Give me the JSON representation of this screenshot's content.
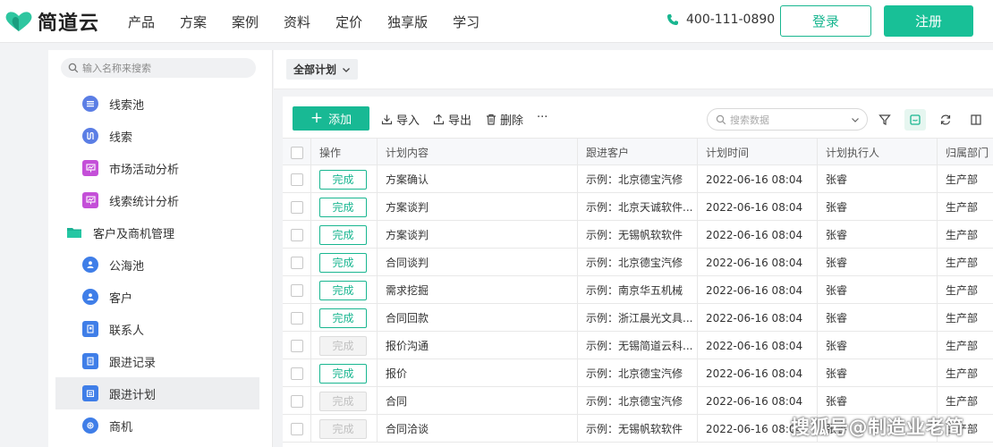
{
  "header": {
    "brand": "简道云",
    "nav": [
      "产品",
      "方案",
      "案例",
      "资料",
      "定价",
      "独享版",
      "学习"
    ],
    "phone": "400-111-0890",
    "login_label": "登录",
    "register_label": "注册"
  },
  "sidebar": {
    "search_placeholder": "输入名称来搜索",
    "items": [
      {
        "label": "线索池",
        "icon": "list-icon",
        "color": "#5b7ee5"
      },
      {
        "label": "线索",
        "icon": "funnel-icon",
        "color": "#5b7ee5"
      },
      {
        "label": "市场活动分析",
        "icon": "chart-icon",
        "color": "#c44fd8"
      },
      {
        "label": "线索统计分析",
        "icon": "chart-icon",
        "color": "#c44fd8"
      },
      {
        "label": "客户及商机管理",
        "icon": "folder-icon",
        "color": "#1ab394"
      },
      {
        "label": "公海池",
        "icon": "users-icon",
        "color": "#3f7ee8"
      },
      {
        "label": "客户",
        "icon": "user-icon",
        "color": "#3f7ee8"
      },
      {
        "label": "联系人",
        "icon": "contact-icon",
        "color": "#3f7ee8"
      },
      {
        "label": "跟进记录",
        "icon": "record-icon",
        "color": "#3f7ee8"
      },
      {
        "label": "跟进计划",
        "icon": "plan-icon",
        "color": "#3f7ee8"
      },
      {
        "label": "商机",
        "icon": "opportunity-icon",
        "color": "#3f7ee8"
      }
    ]
  },
  "view": {
    "selector_label": "全部计划"
  },
  "toolbar": {
    "add_label": "添加",
    "import_label": "导入",
    "export_label": "导出",
    "delete_label": "删除",
    "more_label": "···",
    "search_placeholder": "搜索数据"
  },
  "table": {
    "headers": [
      "操作",
      "计划内容",
      "跟进客户",
      "计划时间",
      "计划执行人",
      "归属部门"
    ],
    "rows": [
      {
        "action": "完成",
        "enabled": true,
        "content": "方案确认",
        "customer": "示例：北京德宝汽修",
        "time": "2022-06-16 08:04",
        "owner": "张睿",
        "dept": "生产部"
      },
      {
        "action": "完成",
        "enabled": true,
        "content": "方案谈判",
        "customer": "示例：北京天诚软件...",
        "time": "2022-06-16 08:04",
        "owner": "张睿",
        "dept": "生产部"
      },
      {
        "action": "完成",
        "enabled": true,
        "content": "方案谈判",
        "customer": "示例：无锡帆软软件",
        "time": "2022-06-16 08:04",
        "owner": "张睿",
        "dept": "生产部"
      },
      {
        "action": "完成",
        "enabled": true,
        "content": "合同谈判",
        "customer": "示例：北京德宝汽修",
        "time": "2022-06-16 08:04",
        "owner": "张睿",
        "dept": "生产部"
      },
      {
        "action": "完成",
        "enabled": true,
        "content": "需求挖掘",
        "customer": "示例：南京华五机械",
        "time": "2022-06-16 08:04",
        "owner": "张睿",
        "dept": "生产部"
      },
      {
        "action": "完成",
        "enabled": true,
        "content": "合同回款",
        "customer": "示例：浙江晨光文具...",
        "time": "2022-06-16 08:04",
        "owner": "张睿",
        "dept": "生产部"
      },
      {
        "action": "完成",
        "enabled": false,
        "content": "报价沟通",
        "customer": "示例：无锡简道云科...",
        "time": "2022-06-16 08:04",
        "owner": "张睿",
        "dept": "生产部"
      },
      {
        "action": "完成",
        "enabled": true,
        "content": "报价",
        "customer": "示例：北京德宝汽修",
        "time": "2022-06-16 08:04",
        "owner": "张睿",
        "dept": "生产部"
      },
      {
        "action": "完成",
        "enabled": false,
        "content": "合同",
        "customer": "示例：北京德宝汽修",
        "time": "2022-06-16 08:04",
        "owner": "张睿",
        "dept": "生产部"
      },
      {
        "action": "完成",
        "enabled": false,
        "content": "合同洽谈",
        "customer": "示例：无锡帆软软件",
        "time": "2022-06-16 08:04",
        "owner": "张睿",
        "dept": "生产部"
      }
    ]
  },
  "watermark": "搜狐号@制造业老简",
  "colors": {
    "accent": "#18b994",
    "disabled": "#c0c0c0"
  }
}
